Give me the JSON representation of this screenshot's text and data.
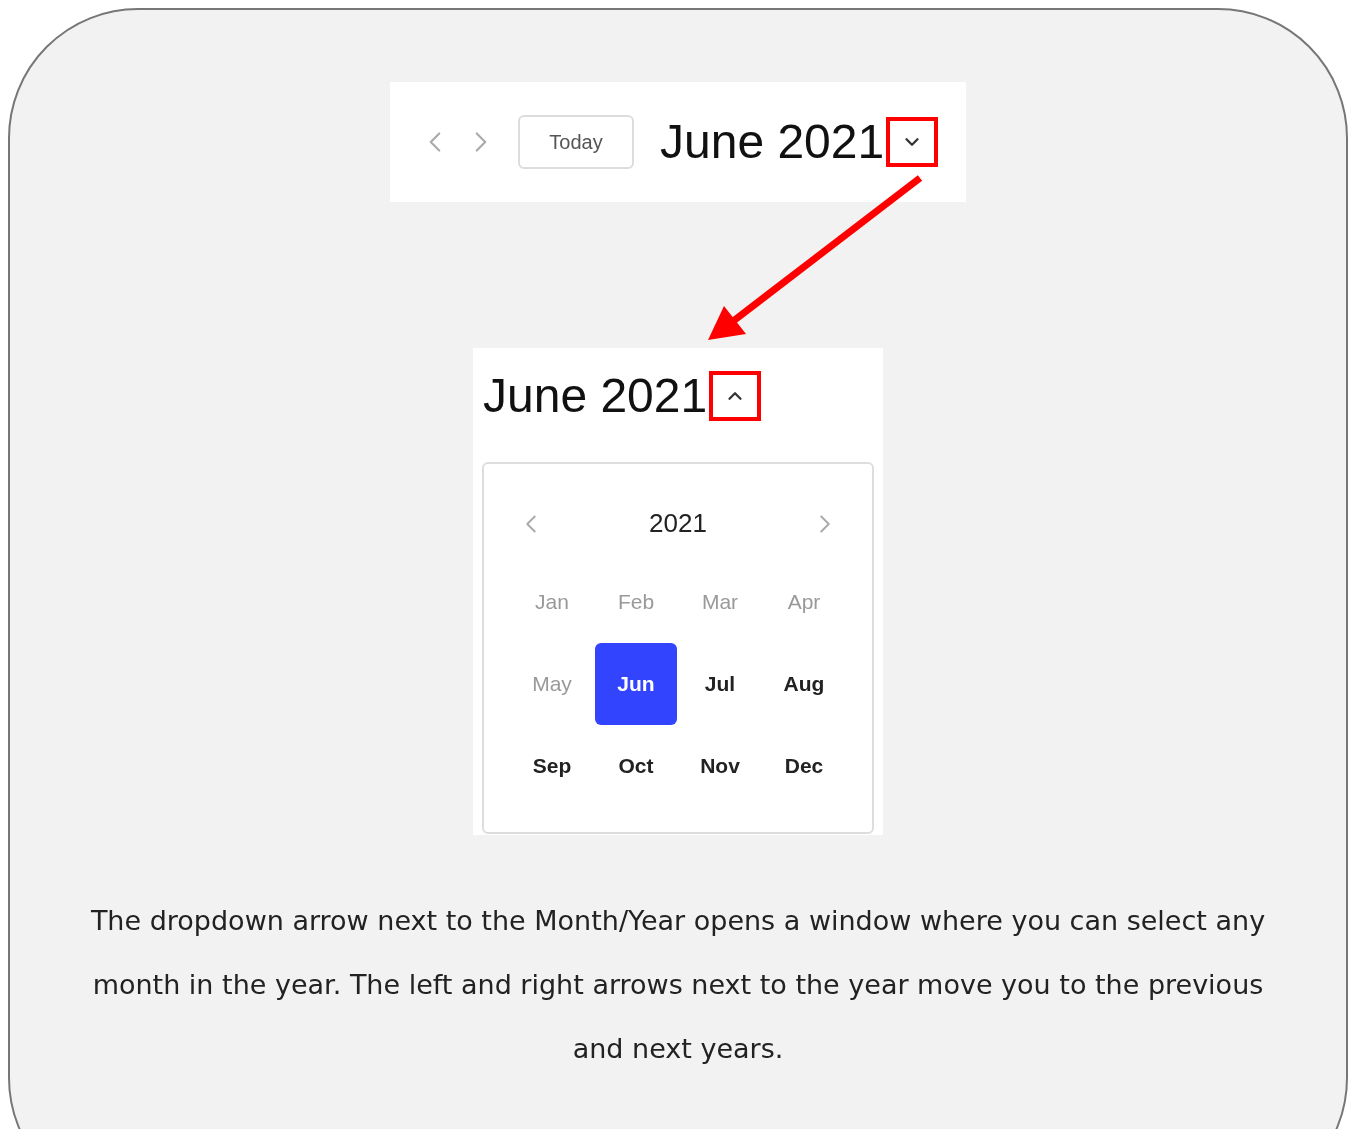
{
  "toolbar": {
    "today_button": "Today",
    "title": "June 2021",
    "dropdown_open": false
  },
  "picker": {
    "title": "June 2021",
    "dropdown_open": true,
    "year": "2021",
    "months": [
      {
        "label": "Jan",
        "past": true,
        "selected": false
      },
      {
        "label": "Feb",
        "past": true,
        "selected": false
      },
      {
        "label": "Mar",
        "past": true,
        "selected": false
      },
      {
        "label": "Apr",
        "past": true,
        "selected": false
      },
      {
        "label": "May",
        "past": true,
        "selected": false
      },
      {
        "label": "Jun",
        "past": false,
        "selected": true
      },
      {
        "label": "Jul",
        "past": false,
        "selected": false
      },
      {
        "label": "Aug",
        "past": false,
        "selected": false
      },
      {
        "label": "Sep",
        "past": false,
        "selected": false
      },
      {
        "label": "Oct",
        "past": false,
        "selected": false
      },
      {
        "label": "Nov",
        "past": false,
        "selected": false
      },
      {
        "label": "Dec",
        "past": false,
        "selected": false
      }
    ]
  },
  "caption": "The dropdown arrow next to the Month/Year opens a window where you can select any month in the year. The left and right arrows next to the year move you to the previous and next years."
}
